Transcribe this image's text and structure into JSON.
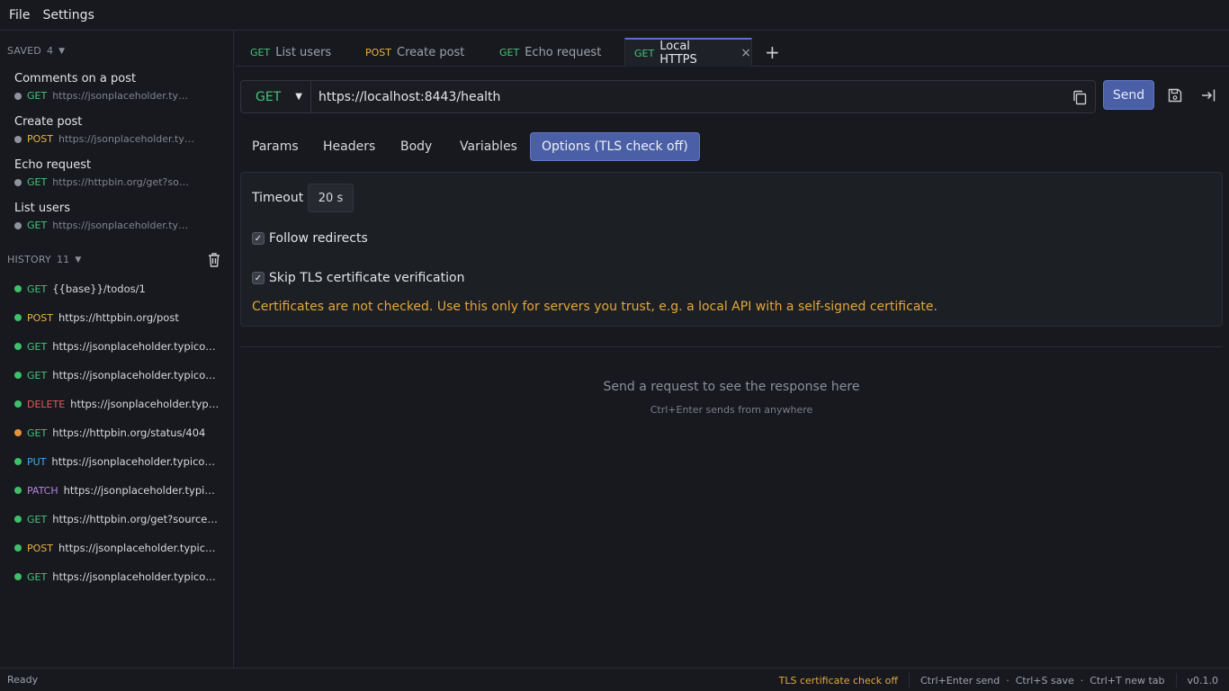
{
  "menu": {
    "file": "File",
    "settings": "Settings"
  },
  "saved": {
    "label": "SAVED",
    "count": "4",
    "items": [
      {
        "name": "Comments on a post",
        "method": "GET",
        "url": "https://jsonplaceholder.typic..."
      },
      {
        "name": "Create post",
        "method": "POST",
        "url": "https://jsonplaceholder.typ..."
      },
      {
        "name": "Echo request",
        "method": "GET",
        "url": "https://httpbin.org/get?sour..."
      },
      {
        "name": "List users",
        "method": "GET",
        "url": "https://jsonplaceholder.typic..."
      }
    ]
  },
  "history": {
    "label": "HISTORY",
    "count": "11",
    "items": [
      {
        "method": "GET",
        "url": "{{base}}/todos/1",
        "status": "green"
      },
      {
        "method": "POST",
        "url": "https://httpbin.org/post",
        "status": "green"
      },
      {
        "method": "GET",
        "url": "https://jsonplaceholder.typicode.c...",
        "status": "green"
      },
      {
        "method": "GET",
        "url": "https://jsonplaceholder.typicode.c...",
        "status": "green"
      },
      {
        "method": "DELETE",
        "url": "https://jsonplaceholder.typico...",
        "status": "green"
      },
      {
        "method": "GET",
        "url": "https://httpbin.org/status/404",
        "status": "orange"
      },
      {
        "method": "PUT",
        "url": "https://jsonplaceholder.typicode....",
        "status": "green"
      },
      {
        "method": "PATCH",
        "url": "https://jsonplaceholder.typico...",
        "status": "green"
      },
      {
        "method": "GET",
        "url": "https://httpbin.org/get?source=pl...",
        "status": "green"
      },
      {
        "method": "POST",
        "url": "https://jsonplaceholder.typicode...",
        "status": "green"
      },
      {
        "method": "GET",
        "url": "https://jsonplaceholder.typicode.c...",
        "status": "green"
      }
    ]
  },
  "tabs": [
    {
      "method": "GET",
      "label": "List users"
    },
    {
      "method": "POST",
      "label": "Create post"
    },
    {
      "method": "GET",
      "label": "Echo request"
    },
    {
      "method": "GET",
      "label": "Local HTTPS",
      "active": true,
      "close": "×"
    }
  ],
  "add_tab": "+",
  "request": {
    "method": "GET",
    "url": "https://localhost:8443/health",
    "send_label": "Send"
  },
  "subtabs": [
    "Params",
    "Headers",
    "Body",
    "Variables",
    "Options (TLS check off)"
  ],
  "options": {
    "timeout_label": "Timeout",
    "timeout_value": "20 s",
    "follow_redirects": "Follow redirects",
    "skip_tls": "Skip TLS certificate verification",
    "warning": "Certificates are not checked. Use this only for servers you trust, e.g. a local API with a self-signed certificate."
  },
  "response": {
    "empty_title": "Send a request to see the response here",
    "empty_hint": "Ctrl+Enter sends from anywhere"
  },
  "status": {
    "left": "Ready",
    "tls": "TLS certificate check off",
    "shortcuts": "Ctrl+Enter send  ·  Ctrl+S save  ·  Ctrl+T new tab",
    "version": "v0.1.0"
  },
  "colors": {
    "accent": "#4a5fa6",
    "warning": "#e3a63a",
    "get": "#46c37b",
    "post": "#e8b341",
    "delete": "#e25b5b",
    "put": "#4aa3e8",
    "patch": "#b483e0"
  }
}
